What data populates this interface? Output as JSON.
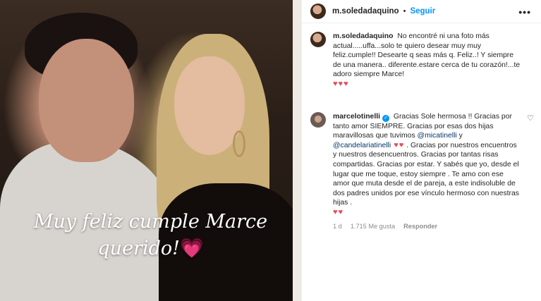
{
  "photo": {
    "overlay_line1": "Muy feliz cumple Marce",
    "overlay_line2": "querido!",
    "overlay_heart": "💗"
  },
  "header": {
    "username": "m.soledadaquino",
    "separator": "•",
    "follow_label": "Seguir",
    "more_label": "•••"
  },
  "caption": {
    "username": "m.soledadaquino",
    "text": "No encontré ni una foto más actual.....uffa...solo te quiero desear muy muy feliz.cumple!! Desearte q seas más q. Feliz..! Y siempre de una manera.. diferente.estare cerca de tu corazón!...te adoro siempre Marce!",
    "hearts": "♥♥♥"
  },
  "reply_comment": {
    "username": "marcelotinelli",
    "verified_mark": "✓",
    "text_1": "Gracias Sole hermosa !! Gracias por tanto amor SIEMPRE. Gracias por esas dos hijas maravillosas que tuvimos ",
    "mention_1": "@micatinelli",
    "text_2": " y ",
    "mention_2": "@candelariatinelli",
    "hearts_inline": " ♥♥",
    "text_3": " . Gracias por nuestros encuentros y nuestros desencuentros. Gracias por tantas risas compartidas. Gracias por estar. Y sabés que yo, desde el lugar que me toque, estoy siempre . Te amo con ese amor que muta desde el de pareja, a este indisoluble de dos padres unidos por ese vínculo hermoso con nuestras hijas .",
    "hearts_end": "♥♥",
    "time": "1 d",
    "likes": "1.715 Me gusta",
    "reply_label": "Responder",
    "like_icon": "♡"
  }
}
